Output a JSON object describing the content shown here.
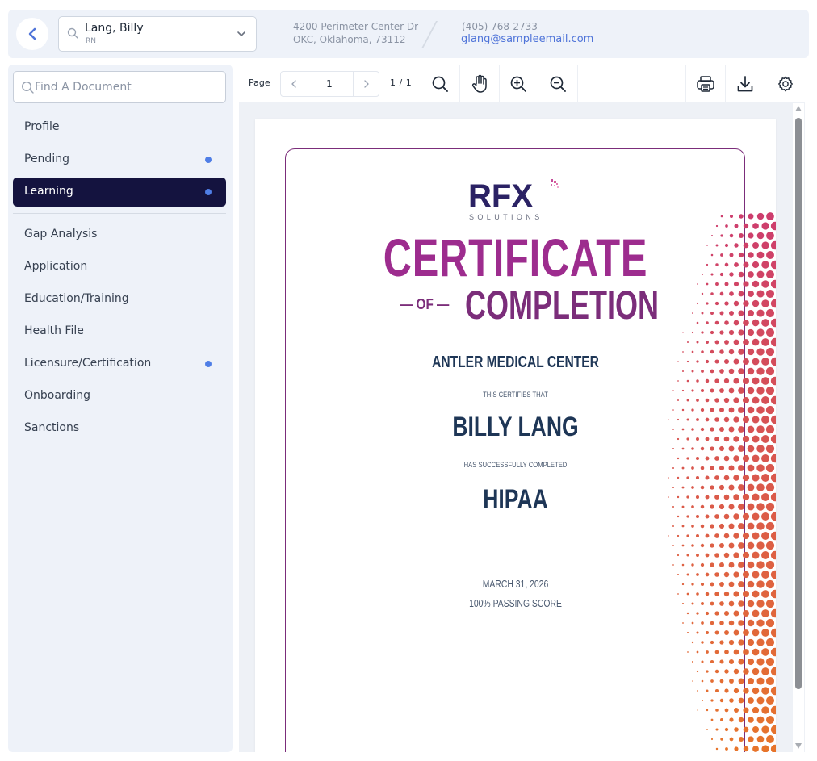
{
  "header": {
    "back_icon": "chevron-left-icon",
    "person": {
      "name": "Lang, Billy",
      "role": "RN"
    },
    "address_line1": "4200 Perimeter Center Dr",
    "address_line2": "OKC, Oklahoma, 73112",
    "phone": "(405) 768-2733",
    "email": "glang@sampleemail.com",
    "accent_color": "#4f74d9"
  },
  "sidebar": {
    "search_placeholder": "Find A Document",
    "items": [
      {
        "label": "Profile",
        "dot": false,
        "active": false
      },
      {
        "label": "Pending",
        "dot": true,
        "active": false
      },
      {
        "label": "Learning",
        "dot": true,
        "active": true
      },
      {
        "label": "Gap Analysis",
        "dot": false,
        "active": false
      },
      {
        "label": "Application",
        "dot": false,
        "active": false
      },
      {
        "label": "Education/Training",
        "dot": false,
        "active": false
      },
      {
        "label": "Health File",
        "dot": false,
        "active": false
      },
      {
        "label": "Licensure/Certification",
        "dot": true,
        "active": false
      },
      {
        "label": "Onboarding",
        "dot": false,
        "active": false
      },
      {
        "label": "Sanctions",
        "dot": false,
        "active": false
      }
    ],
    "active_color": "#14133f",
    "dot_color": "#4f7ee6"
  },
  "viewer": {
    "page_label": "Page",
    "current_page": "1",
    "page_count": "1 / 1",
    "tools": [
      "search-icon",
      "hand-pan-icon",
      "zoom-in-icon",
      "zoom-out-icon",
      "print-icon",
      "download-icon",
      "settings-gear-icon"
    ]
  },
  "certificate": {
    "logo_text": "RFX",
    "logo_sub": "SOLUTIONS",
    "title_line1": "CERTIFICATE",
    "title_of": "— OF —",
    "title_line2": "COMPLETION",
    "organization": "ANTLER MEDICAL CENTER",
    "certifies_text": "THIS CERTIFIES THAT",
    "recipient": "BILLY LANG",
    "completed_text": "HAS SUCCESSFULLY COMPLETED",
    "course": "HIPAA",
    "date": "MARCH 31, 2026",
    "score": "100% PASSING SCORE",
    "title_color": "#9d2c8e",
    "text_color": "#1e3656"
  }
}
